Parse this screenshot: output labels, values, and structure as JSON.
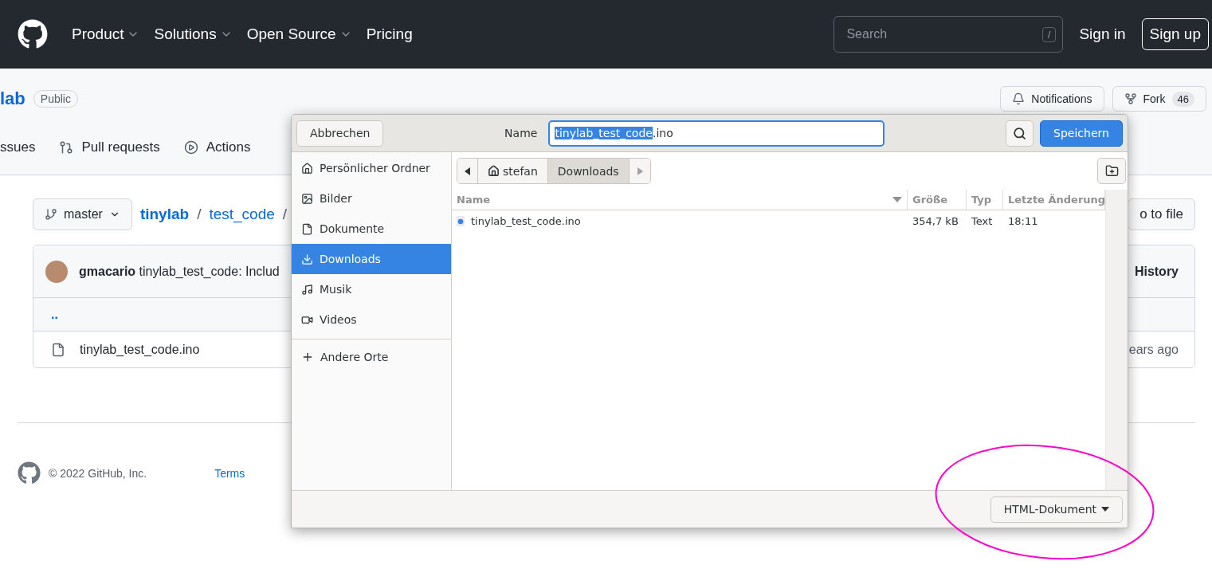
{
  "header": {
    "nav": [
      {
        "label": "Product",
        "dropdown": true
      },
      {
        "label": "Solutions",
        "dropdown": true
      },
      {
        "label": "Open Source",
        "dropdown": true
      },
      {
        "label": "Pricing",
        "dropdown": false
      }
    ],
    "search": {
      "placeholder": "Search",
      "shortcut": "/"
    },
    "sign_in": "Sign in",
    "sign_up": "Sign up"
  },
  "repo": {
    "name": "lab",
    "visibility": "Public",
    "notifications": "Notifications",
    "fork": {
      "label": "Fork",
      "count": "46"
    }
  },
  "repo_tabs": [
    {
      "label": "ssues",
      "kind": "plain"
    },
    {
      "label": "Pull requests",
      "kind": "pull"
    },
    {
      "label": "Actions",
      "kind": "actions"
    }
  ],
  "branch": "master",
  "breadcrumb": [
    {
      "kind": "repo",
      "label": "tinylab"
    },
    {
      "kind": "separator",
      "label": "/"
    },
    {
      "kind": "folder",
      "label": "test_code"
    },
    {
      "kind": "separator",
      "label": "/"
    }
  ],
  "go_to_file": "o to file",
  "commit": {
    "author": "gmacario",
    "message": "tinylab_test_code: Includ",
    "history": "History"
  },
  "files": [
    {
      "kind": "parent",
      "name": ".."
    },
    {
      "kind": "file",
      "name": "tinylab_test_code.ino",
      "age": "ears ago"
    }
  ],
  "footer": {
    "copyright": "© 2022 GitHub, Inc.",
    "links": [
      "Terms"
    ]
  },
  "dialog": {
    "cancel": "Abbrechen",
    "name_label": "Name",
    "name_field": {
      "selected_part": "tinylab_test_code",
      "rest": ".ino"
    },
    "save": "Speichern",
    "places": [
      {
        "label": "Persönlicher Ordner",
        "kind": "home",
        "selected": false
      },
      {
        "label": "Bilder",
        "kind": "image",
        "selected": false
      },
      {
        "label": "Dokumente",
        "kind": "document",
        "selected": false
      },
      {
        "label": "Downloads",
        "kind": "download",
        "selected": true
      },
      {
        "label": "Musik",
        "kind": "music",
        "selected": false
      },
      {
        "label": "Videos",
        "kind": "video",
        "selected": false
      }
    ],
    "other_places": "Andere Orte",
    "path": [
      {
        "label": "stefan",
        "kind": "home",
        "selected": false
      },
      {
        "label": "Downloads",
        "kind": "folder",
        "selected": true
      }
    ],
    "columns": [
      "Name",
      "Größe",
      "Typ",
      "Letzte Änderung"
    ],
    "files": [
      {
        "name": "tinylab_test_code.ino",
        "size": "354,7 kB",
        "type": "Text",
        "modified": "18:11"
      }
    ],
    "filter": "HTML-Dokument"
  }
}
